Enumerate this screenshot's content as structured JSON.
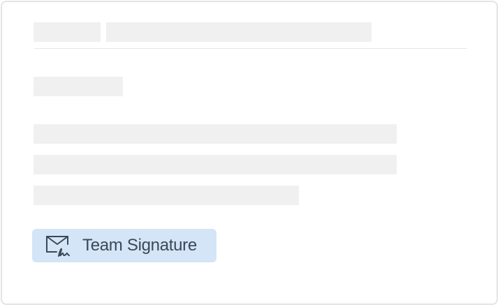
{
  "email_preview": {
    "signature_badge": {
      "label": "Team Signature",
      "icon": "envelope-signature-icon",
      "background_color": "#d3e5f6",
      "text_color": "#3b4858"
    },
    "placeholder_color": "#f0f0f0"
  }
}
